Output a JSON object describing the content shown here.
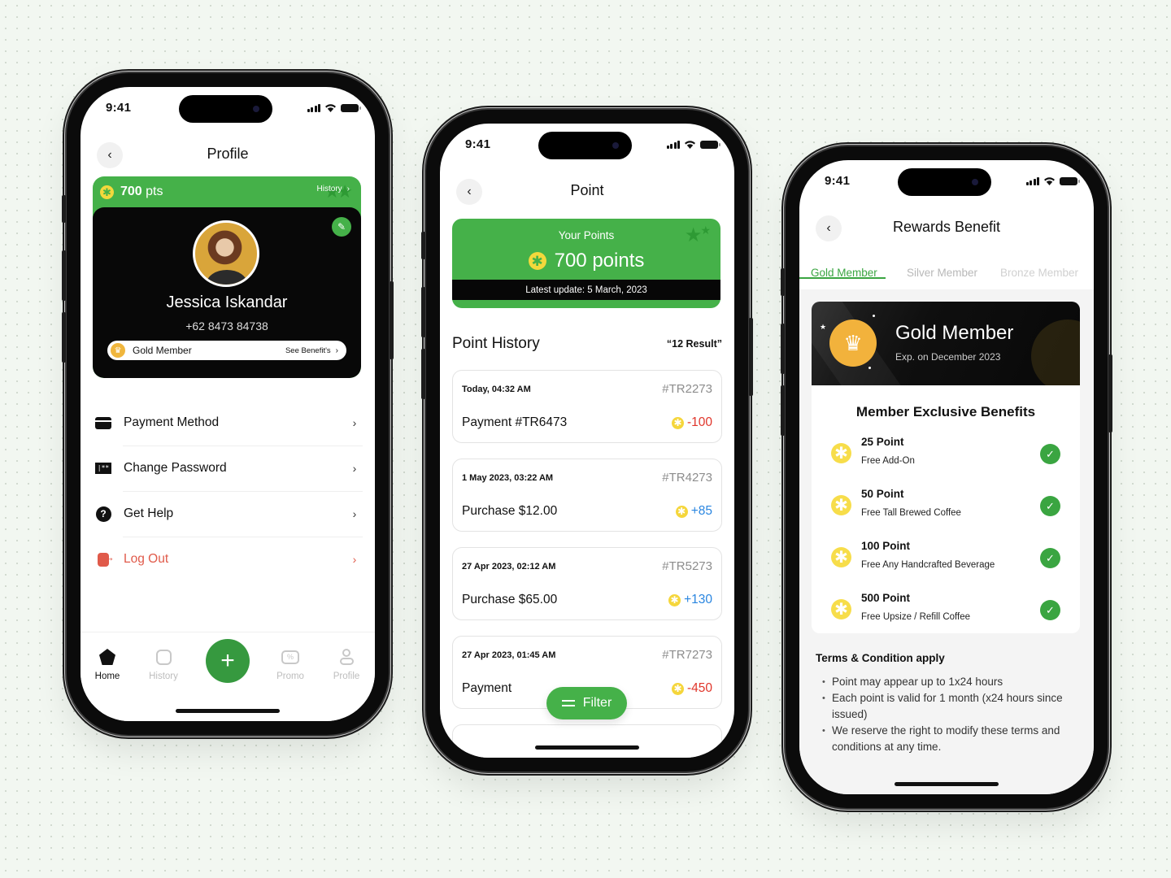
{
  "status_bar": {
    "time": "9:41"
  },
  "profile_screen": {
    "title": "Profile",
    "points_label": "700",
    "points_unit": "pts",
    "history_link": "History",
    "user": {
      "name": "Jessica Iskandar",
      "phone": "+62 8473 84738"
    },
    "membership": {
      "tier": "Gold Member",
      "see_benefits": "See Benefit's"
    },
    "menu": [
      {
        "label": "Payment Method",
        "icon": "credit-card-icon"
      },
      {
        "label": "Change Password",
        "icon": "password-icon"
      },
      {
        "label": "Get Help",
        "icon": "help-icon"
      },
      {
        "label": "Log Out",
        "icon": "logout-icon",
        "danger": true
      }
    ],
    "tabbar": [
      {
        "label": "Home",
        "icon": "home-icon",
        "active": true
      },
      {
        "label": "History",
        "icon": "history-icon",
        "active": false
      },
      {
        "label": "Promo",
        "icon": "promo-icon",
        "active": false
      },
      {
        "label": "Profile",
        "icon": "profile-icon",
        "active": false
      }
    ],
    "fab_icon": "+"
  },
  "point_screen": {
    "title": "Point",
    "your_points_label": "Your Points",
    "points_value": "700 points",
    "latest_update": "Latest update: 5 March, 2023",
    "history_title": "Point History",
    "result_count": "“12 Result”",
    "transactions": [
      {
        "date": "Today, 04:32 AM",
        "id": "#TR2273",
        "desc": "Payment #TR6473",
        "points": "-100",
        "type": "neg"
      },
      {
        "date": "1 May 2023, 03:22 AM",
        "id": "#TR4273",
        "desc": "Purchase $12.00",
        "points": "+85",
        "type": "pos"
      },
      {
        "date": "27 Apr 2023, 02:12 AM",
        "id": "#TR5273",
        "desc": "Purchase $65.00",
        "points": "+130",
        "type": "pos"
      },
      {
        "date": "27 Apr 2023, 01:45 AM",
        "id": "#TR7273",
        "desc": "Payment",
        "points": "-450",
        "type": "neg"
      }
    ],
    "filter_label": "Filter"
  },
  "rewards_screen": {
    "title": "Rewards Benefit",
    "tabs": [
      "Gold Member",
      "Silver Member",
      "Bronze Member"
    ],
    "active_tab": "Gold Member",
    "card": {
      "title": "Gold Member",
      "expiry": "Exp. on December 2023"
    },
    "benefits_title": "Member Exclusive Benefits",
    "benefits": [
      {
        "points": "25 Point",
        "desc": "Free Add-On"
      },
      {
        "points": "50 Point",
        "desc": "Free Tall Brewed Coffee"
      },
      {
        "points": "100 Point",
        "desc": "Free Any Handcrafted Beverage"
      },
      {
        "points": "500 Point",
        "desc": "Free Upsize / Refill Coffee"
      }
    ],
    "terms_title": "Terms & Condition apply",
    "terms": [
      "Point may appear up to 1x24 hours",
      "Each point is valid for 1 month (x24 hours since issued)",
      "We reserve the right to modify these terms and conditions at any time."
    ]
  },
  "colors": {
    "brand_green": "#45b149",
    "dark_green": "#36993f",
    "coin_yellow": "#f3d83c",
    "negative_red": "#e0362b",
    "positive_blue": "#2a86e0",
    "logout_red": "#e05a4a",
    "gold": "#f2b23c"
  }
}
